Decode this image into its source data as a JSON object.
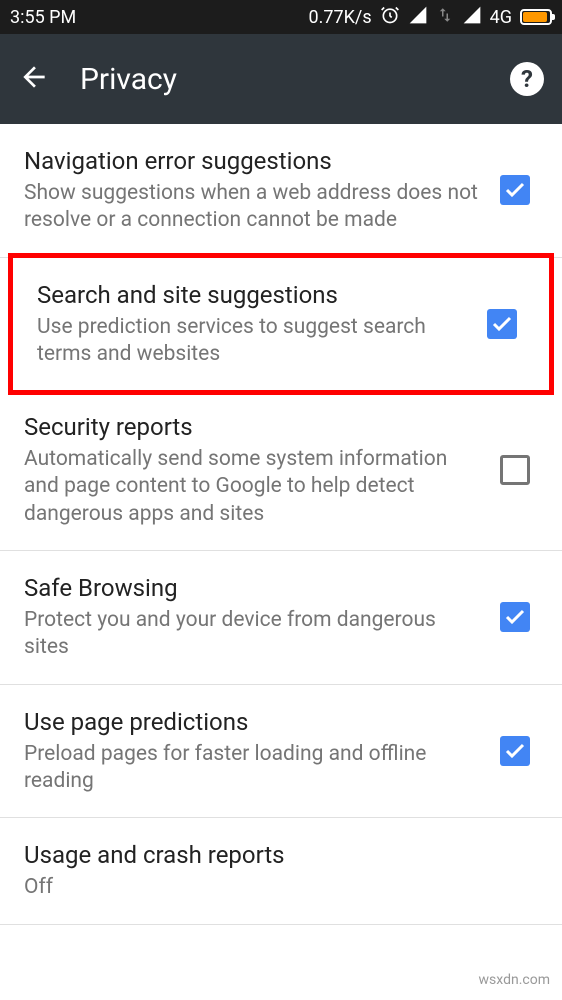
{
  "status": {
    "time": "3:55 PM",
    "speed": "0.77K/s",
    "network": "4G"
  },
  "header": {
    "title": "Privacy"
  },
  "settings": [
    {
      "title": "Navigation error suggestions",
      "desc": "Show suggestions when a web address does not resolve or a connection cannot be made",
      "checked": true,
      "highlighted": false
    },
    {
      "title": "Search and site suggestions",
      "desc": "Use prediction services to suggest search terms and websites",
      "checked": true,
      "highlighted": true
    },
    {
      "title": "Security reports",
      "desc": "Automatically send some system information and page content to Google to help detect dangerous apps and sites",
      "checked": false,
      "highlighted": false
    },
    {
      "title": "Safe Browsing",
      "desc": "Protect you and your device from dangerous sites",
      "checked": true,
      "highlighted": false
    },
    {
      "title": "Use page predictions",
      "desc": "Preload pages for faster loading and offline reading",
      "checked": true,
      "highlighted": false
    },
    {
      "title": "Usage and crash reports",
      "desc": "Off",
      "checked": null,
      "highlighted": false
    }
  ],
  "watermark": "wsxdn.com"
}
